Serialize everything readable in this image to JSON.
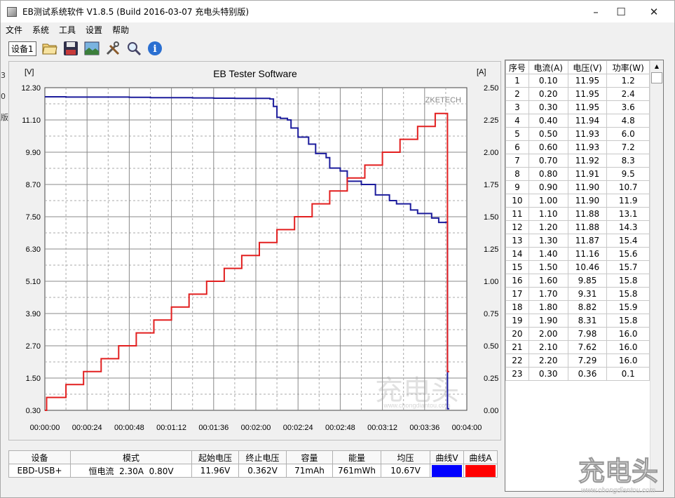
{
  "window": {
    "title": "EB测试系统软件 V1.8.5 (Build 2016-03-07 充电头特别版)",
    "min_glyph": "–",
    "max_glyph": "☐",
    "close_glyph": "✕"
  },
  "menu": [
    "文件",
    "系统",
    "工具",
    "设置",
    "帮助"
  ],
  "toolbar": {
    "device_tab": "设备1",
    "icons": [
      "folder-open-icon",
      "save-icon",
      "image-icon",
      "tools-icon",
      "search-icon",
      "info-icon"
    ]
  },
  "left_bleed": [
    "3",
    "0",
    "版"
  ],
  "chart_data": {
    "type": "line",
    "title": "EB Tester Software",
    "watermark": "ZKETECH",
    "y_left_unit": "[V]",
    "y_right_unit": "[A]",
    "y_left_ticks": [
      "12.30",
      "11.10",
      "9.90",
      "8.70",
      "7.50",
      "6.30",
      "5.10",
      "3.90",
      "2.70",
      "1.50",
      "0.30"
    ],
    "y_right_ticks": [
      "2.50",
      "2.25",
      "2.00",
      "1.75",
      "1.50",
      "1.25",
      "1.00",
      "0.75",
      "0.50",
      "0.25",
      "0.00"
    ],
    "x_ticks": [
      "00:00:00",
      "00:00:24",
      "00:00:48",
      "00:01:12",
      "00:01:36",
      "00:02:00",
      "00:02:24",
      "00:02:48",
      "00:03:12",
      "00:03:36",
      "00:04:00"
    ],
    "ylim_left": [
      0.3,
      12.3
    ],
    "ylim_right": [
      0.0,
      2.5
    ],
    "xlim_seconds": [
      0,
      240
    ],
    "grid": true,
    "series": [
      {
        "name": "曲线V",
        "color": "#1c1c9c",
        "axis": "left",
        "points": [
          [
            0,
            11.96
          ],
          [
            12,
            11.95
          ],
          [
            24,
            11.95
          ],
          [
            36,
            11.95
          ],
          [
            48,
            11.94
          ],
          [
            60,
            11.93
          ],
          [
            72,
            11.93
          ],
          [
            84,
            11.92
          ],
          [
            96,
            11.91
          ],
          [
            108,
            11.9
          ],
          [
            120,
            11.9
          ],
          [
            128,
            11.88
          ],
          [
            130,
            11.6
          ],
          [
            132,
            11.2
          ],
          [
            134,
            11.16
          ],
          [
            138,
            11.1
          ],
          [
            140,
            10.8
          ],
          [
            144,
            10.46
          ],
          [
            150,
            10.2
          ],
          [
            154,
            9.85
          ],
          [
            160,
            9.7
          ],
          [
            162,
            9.31
          ],
          [
            168,
            9.2
          ],
          [
            172,
            8.82
          ],
          [
            180,
            8.7
          ],
          [
            188,
            8.31
          ],
          [
            196,
            8.1
          ],
          [
            200,
            7.98
          ],
          [
            208,
            7.75
          ],
          [
            212,
            7.62
          ],
          [
            220,
            7.45
          ],
          [
            224,
            7.29
          ],
          [
            228,
            7.3
          ],
          [
            229,
            0.36
          ],
          [
            230,
            0.36
          ]
        ]
      },
      {
        "name": "曲线A",
        "color": "#e21f1f",
        "axis": "right",
        "points": [
          [
            0,
            0.0
          ],
          [
            1,
            0.1
          ],
          [
            12,
            0.2
          ],
          [
            22,
            0.3
          ],
          [
            32,
            0.4
          ],
          [
            42,
            0.5
          ],
          [
            52,
            0.6
          ],
          [
            62,
            0.7
          ],
          [
            72,
            0.8
          ],
          [
            82,
            0.9
          ],
          [
            92,
            1.0
          ],
          [
            102,
            1.1
          ],
          [
            112,
            1.2
          ],
          [
            122,
            1.3
          ],
          [
            132,
            1.4
          ],
          [
            142,
            1.5
          ],
          [
            152,
            1.6
          ],
          [
            162,
            1.7
          ],
          [
            172,
            1.8
          ],
          [
            182,
            1.9
          ],
          [
            192,
            2.0
          ],
          [
            202,
            2.1
          ],
          [
            212,
            2.2
          ],
          [
            222,
            2.3
          ],
          [
            229,
            2.3
          ],
          [
            229,
            0.3
          ],
          [
            230,
            0.3
          ]
        ]
      }
    ]
  },
  "table": {
    "headers": [
      "序号",
      "电流(A)",
      "电压(V)",
      "功率(W)"
    ],
    "rows": [
      [
        "1",
        "0.10",
        "11.95",
        "1.2"
      ],
      [
        "2",
        "0.20",
        "11.95",
        "2.4"
      ],
      [
        "3",
        "0.30",
        "11.95",
        "3.6"
      ],
      [
        "4",
        "0.40",
        "11.94",
        "4.8"
      ],
      [
        "5",
        "0.50",
        "11.93",
        "6.0"
      ],
      [
        "6",
        "0.60",
        "11.93",
        "7.2"
      ],
      [
        "7",
        "0.70",
        "11.92",
        "8.3"
      ],
      [
        "8",
        "0.80",
        "11.91",
        "9.5"
      ],
      [
        "9",
        "0.90",
        "11.90",
        "10.7"
      ],
      [
        "10",
        "1.00",
        "11.90",
        "11.9"
      ],
      [
        "11",
        "1.10",
        "11.88",
        "13.1"
      ],
      [
        "12",
        "1.20",
        "11.88",
        "14.3"
      ],
      [
        "13",
        "1.30",
        "11.87",
        "15.4"
      ],
      [
        "14",
        "1.40",
        "11.16",
        "15.6"
      ],
      [
        "15",
        "1.50",
        "10.46",
        "15.7"
      ],
      [
        "16",
        "1.60",
        "9.85",
        "15.8"
      ],
      [
        "17",
        "1.70",
        "9.31",
        "15.8"
      ],
      [
        "18",
        "1.80",
        "8.82",
        "15.9"
      ],
      [
        "19",
        "1.90",
        "8.31",
        "15.8"
      ],
      [
        "20",
        "2.00",
        "7.98",
        "16.0"
      ],
      [
        "21",
        "2.10",
        "7.62",
        "16.0"
      ],
      [
        "22",
        "2.20",
        "7.29",
        "16.0"
      ],
      [
        "23",
        "0.30",
        "0.36",
        "0.1"
      ]
    ]
  },
  "summary": {
    "headers": [
      "设备",
      "模式",
      "起始电压",
      "终止电压",
      "容量",
      "能量",
      "均压",
      "曲线V",
      "曲线A"
    ],
    "values": [
      "EBD-USB+",
      "恒电流  2.30A  0.80V",
      "11.96V",
      "0.362V",
      "71mAh",
      "761mWh",
      "10.67V"
    ],
    "swatch_v": "#0000ff",
    "swatch_a": "#ff0000"
  },
  "watermark": {
    "logo_text": "充电头",
    "url": "www.chongdiantou.com"
  }
}
